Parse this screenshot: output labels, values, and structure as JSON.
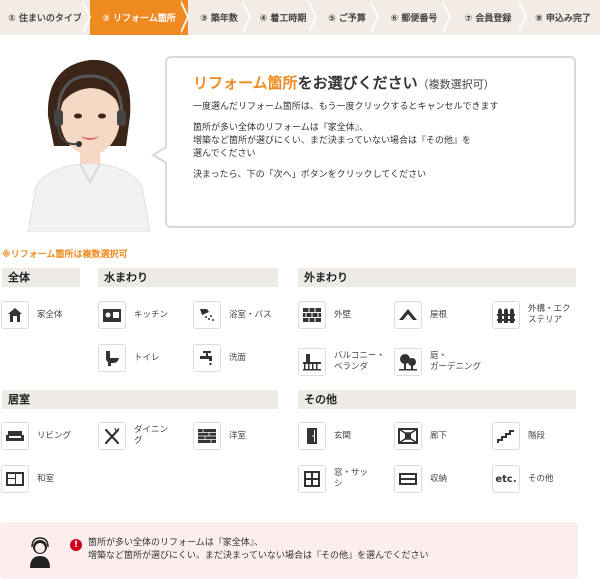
{
  "steps": [
    {
      "label": "① 住まいのタイプ",
      "active": false
    },
    {
      "label": "② リフォーム箇所",
      "active": true
    },
    {
      "label": "③ 築年数",
      "active": false
    },
    {
      "label": "④ 着工時期",
      "active": false
    },
    {
      "label": "⑤ ご予算",
      "active": false
    },
    {
      "label": "⑥ 郵便番号",
      "active": false
    },
    {
      "label": "⑦ 会員登録",
      "active": false
    },
    {
      "label": "⑧ 申込み完了",
      "active": false
    }
  ],
  "bubble": {
    "title_highlight": "リフォーム箇所",
    "title_rest": "をお選びください",
    "title_sub": "（複数選択可）",
    "p1": "一度選んだリフォーム箇所は、もう一度クリックするとキャンセルできます",
    "p2": "箇所が多い全体のリフォームは『家全体』、\n増築など箇所が選びにくい、まだ決まっていない場合は『その他』を\n選んでください",
    "p3": "決まったら、下の「次へ」ボタンをクリックしてください"
  },
  "note": "※リフォーム箇所は複数選択可",
  "categories": {
    "zentai": "全体",
    "mizumawari": "水まわり",
    "sotomawari": "外まわり",
    "kyoshitsu": "居室",
    "sonota": "その他"
  },
  "items": {
    "whole_house": "家全体",
    "kitchen": "キッチン",
    "bath": "浴室・バス",
    "toilet": "トイレ",
    "washroom": "洗面",
    "exterior_wall": "外壁",
    "roof": "屋根",
    "exterior": "外構・エク\nステリア",
    "balcony": "バルコニー・\nベランダ",
    "garden": "庭・\nガーデニング",
    "living": "リビング",
    "dining": "ダイニン\nグ",
    "western_room": "洋室",
    "japanese_room": "和室",
    "entrance": "玄関",
    "hallway": "廊下",
    "stairs": "階段",
    "window": "窓・サッ\nシ",
    "storage": "収納",
    "other": "その他",
    "other_icon_text": "etc."
  },
  "warning": {
    "icon": "!",
    "text": "箇所が多い全体のリフォームは『家全体』、\n増築など箇所が選びにくい、まだ決まっていない場合は『その他』を選んでください"
  },
  "colors": {
    "accent": "#ee8a1f",
    "panel": "#eeebe7",
    "warn_bg": "#fdeeee",
    "warn_icon": "#d0021b"
  }
}
